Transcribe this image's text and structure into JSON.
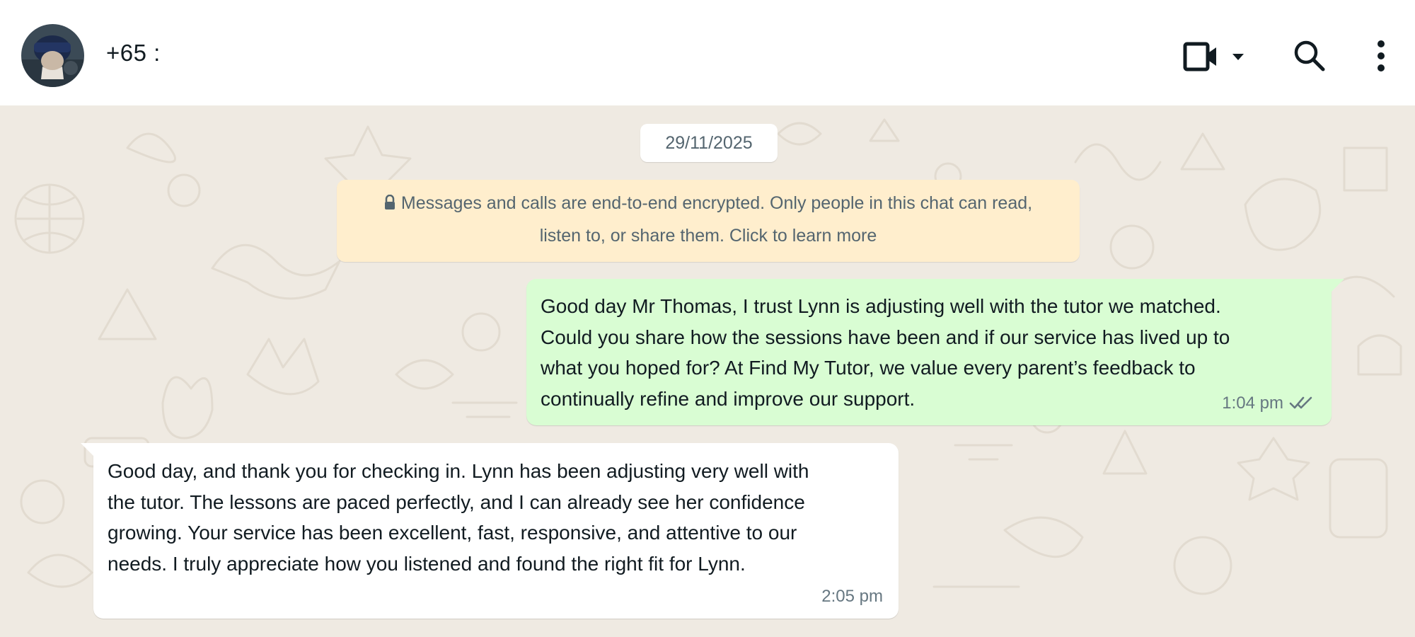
{
  "header": {
    "contact_name": "+65 :",
    "avatar_icon": "profile-photo",
    "icons": [
      "video-call-icon",
      "chevron-down-icon",
      "search-icon",
      "more-vertical-icon"
    ]
  },
  "chat": {
    "date_chip": "29/11/2025",
    "encryption_notice": {
      "line1": "Messages and calls are end-to-end encrypted. Only people in this chat can read,",
      "line2": "listen to, or share them. Click to learn more",
      "icon": "lock-icon"
    },
    "messages": [
      {
        "direction": "outgoing",
        "lines": [
          "Good day Mr Thomas, I trust Lynn is adjusting well with the tutor we matched.",
          "Could you share how the sessions have been and if our service has lived up to",
          "what you hoped for? At Find My Tutor, we value every parent’s feedback to",
          "continually refine and improve our support."
        ],
        "time": "1:04 pm",
        "status": "read-double-tick-icon"
      },
      {
        "direction": "incoming",
        "lines": [
          "Good day, and thank you for checking in. Lynn has been adjusting very well with",
          "the tutor. The lessons are paced perfectly, and I can already see her confidence",
          "growing. Your service has been excellent, fast, responsive, and attentive to our",
          "needs. I truly appreciate how you listened and found the right fit for Lynn."
        ],
        "time": "2:05 pm"
      }
    ]
  },
  "colors": {
    "chat_background": "#efeae2",
    "outgoing_bubble": "#d9fdd3",
    "incoming_bubble": "#ffffff",
    "notice_background": "#ffeecd",
    "read_tick": "#667781"
  }
}
